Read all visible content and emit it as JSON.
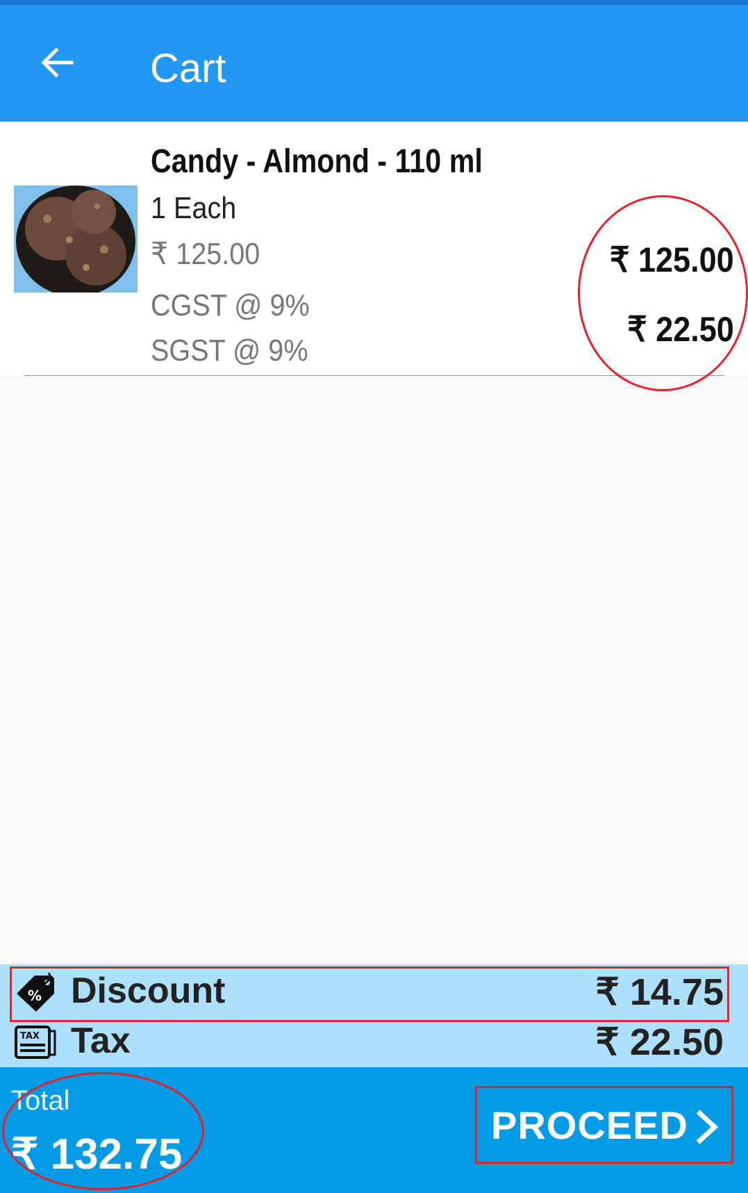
{
  "app_bar": {
    "back_icon": "arrow-left-icon",
    "title": "Cart",
    "background_color": "#2196f3"
  },
  "cart_item": {
    "thumbnail_icon": "chocolate-ice-cream-image",
    "name": "Candy - Almond - 110 ml",
    "quantity": "1 Each",
    "unit_price": "₹ 125.00",
    "cgst_label": "CGST @ 9%",
    "sgst_label": "SGST @ 9%",
    "amount": "₹ 125.00",
    "tax_amount": "₹ 22.50"
  },
  "summary": {
    "discount": {
      "icon": "discount-tag-icon",
      "label": "Discount",
      "value": "₹ 14.75"
    },
    "tax": {
      "icon": "tax-receipt-icon",
      "label": "Tax",
      "value": "₹ 22.50"
    },
    "background_color": "#ade0fb"
  },
  "footer": {
    "total_label": "Total",
    "total_value": "₹ 132.75",
    "proceed_label": "PROCEED",
    "proceed_icon": "chevron-right-icon",
    "background_color": "#039be5"
  },
  "annotation_color": "#e8202a"
}
